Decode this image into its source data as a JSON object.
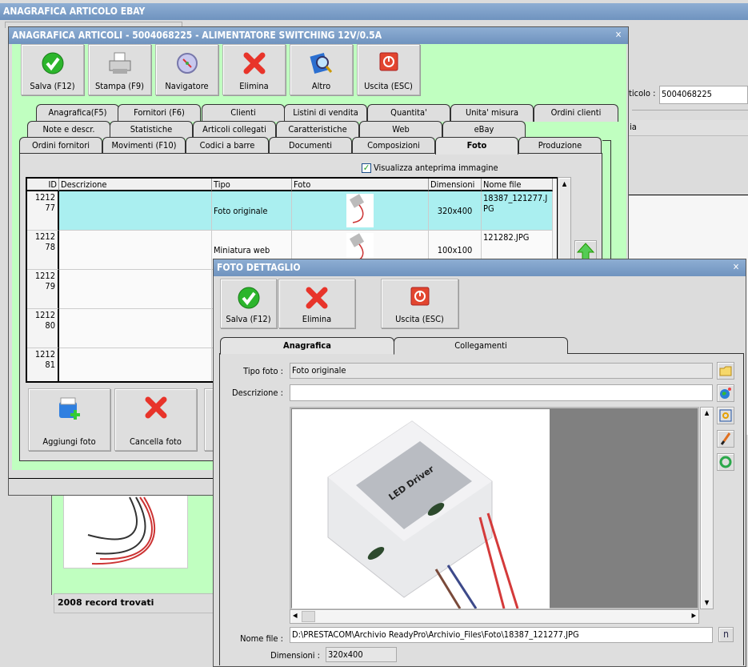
{
  "back_window": {
    "title": "ANAGRAFICA ARTICOLO EBAY",
    "codice_label": "ticolo :",
    "codice_value": "5004068225",
    "partial_label": "ia",
    "status": "2008 record trovati"
  },
  "main_window": {
    "title": "ANAGRAFICA ARTICOLI - 5004068225 - ALIMENTATORE SWITCHING 12V/0.5A",
    "toolbar": [
      {
        "label": "Salva (F12)",
        "icon": "check-icon"
      },
      {
        "label": "Stampa (F9)",
        "icon": "printer-icon"
      },
      {
        "label": "Navigatore",
        "icon": "compass-icon"
      },
      {
        "label": "Elimina",
        "icon": "delete-x-icon"
      },
      {
        "label": "Altro",
        "icon": "search-book-icon"
      },
      {
        "label": "Uscita (ESC)",
        "icon": "power-icon"
      }
    ],
    "tabs_row1": [
      "Anagrafica(F5)",
      "Fornitori (F6)",
      "Clienti",
      "Listini di vendita",
      "Quantita'",
      "Unita' misura",
      "Ordini clienti"
    ],
    "tabs_row2": [
      "Note e descr.",
      "Statistiche",
      "Articoli collegati",
      "Caratteristiche",
      "Web",
      "eBay"
    ],
    "tabs_row3": [
      "Ordini fornitori",
      "Movimenti (F10)",
      "Codici a barre",
      "Documenti",
      "Composizioni",
      "Foto",
      "Produzione"
    ],
    "selected_tab": "Foto",
    "preview_checkbox": {
      "label": "Visualizza anteprima immagine",
      "checked": true
    },
    "grid": {
      "columns": [
        "ID",
        "Descrizione",
        "Tipo",
        "Foto",
        "Dimensioni",
        "Nome file"
      ],
      "rows": [
        {
          "id": "121277",
          "descrizione": "",
          "tipo": "Foto originale",
          "dimensioni": "320x400",
          "nome_file": "18387_121277.JPG",
          "selected": true
        },
        {
          "id": "121278",
          "descrizione": "",
          "tipo": "Miniatura web",
          "dimensioni": "100x100",
          "nome_file": "121282.JPG"
        },
        {
          "id": "121279",
          "descrizione": ""
        },
        {
          "id": "121280",
          "descrizione": ""
        },
        {
          "id": "121281",
          "descrizione": ""
        }
      ]
    },
    "bottom_buttons": [
      {
        "label": "Aggiungi foto",
        "icon": "add-photo-icon"
      },
      {
        "label": "Cancella foto",
        "icon": "delete-x-icon"
      }
    ]
  },
  "detail_window": {
    "title": "FOTO DETTAGLIO",
    "toolbar": [
      {
        "label": "Salva (F12)",
        "icon": "check-icon"
      },
      {
        "label": "Elimina",
        "icon": "delete-x-icon"
      },
      {
        "label": "Uscita (ESC)",
        "icon": "power-icon"
      }
    ],
    "tabs": [
      "Anagrafica",
      "Collegamenti"
    ],
    "selected_tab": "Anagrafica",
    "tipo_foto_label": "Tipo foto :",
    "tipo_foto_value": "Foto originale",
    "descrizione_label": "Descrizione :",
    "descrizione_value": "",
    "nome_file_label": "Nome file :",
    "nome_file_value": "D:\\PRESTACOM\\Archivio ReadyPro\\Archivio_Files\\Foto\\18387_121277.JPG",
    "dimensioni_label": "Dimensioni :",
    "dimensioni_value": "320x400",
    "n_button": "n"
  },
  "colors": {
    "titlebar": "#7a9cc4",
    "green_panel": "#c0ffc0",
    "selected_row": "#aaeff0",
    "window_bg": "#dcdcdc"
  }
}
